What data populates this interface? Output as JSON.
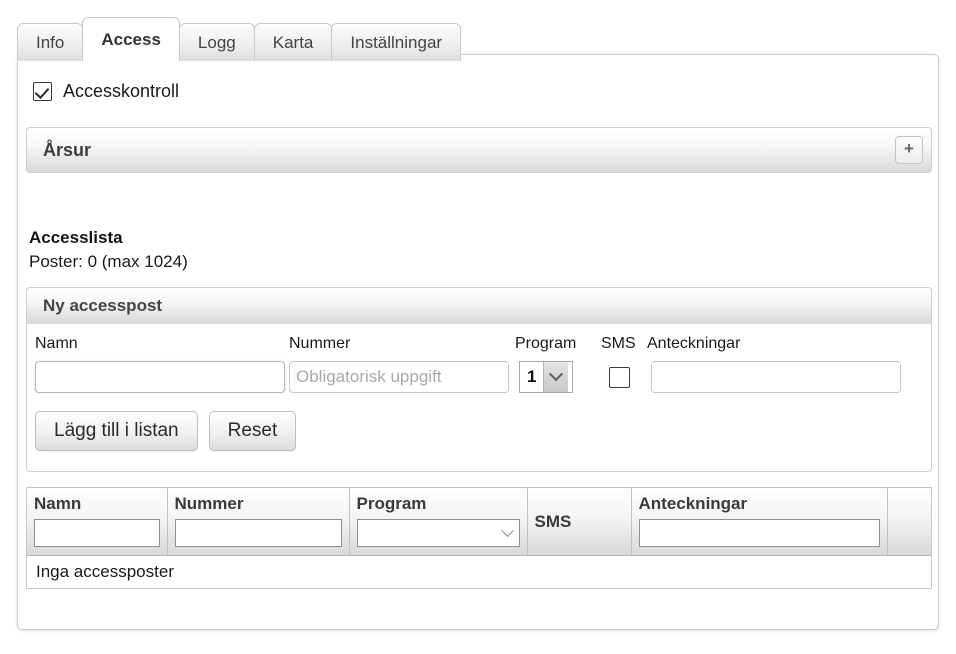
{
  "tabs": [
    {
      "label": "Info",
      "active": false
    },
    {
      "label": "Access",
      "active": true
    },
    {
      "label": "Logg",
      "active": false
    },
    {
      "label": "Karta",
      "active": false
    },
    {
      "label": "Inställningar",
      "active": false
    }
  ],
  "access_control": {
    "label": "Accesskontroll",
    "checked": true
  },
  "yearclock_panel": {
    "title": "Årsur",
    "add_button_label": "+",
    "add_button_icon": "plus-icon"
  },
  "access_list": {
    "title": "Accesslista",
    "count_text": "Poster: 0 (max 1024)"
  },
  "new_entry": {
    "header": "Ny accesspost",
    "labels": {
      "name": "Namn",
      "number": "Nummer",
      "program": "Program",
      "sms": "SMS",
      "notes": "Anteckningar"
    },
    "name_value": "",
    "name_placeholder": "",
    "number_value": "",
    "number_placeholder": "Obligatorisk uppgift",
    "program_value": "1",
    "program_options": [
      "1"
    ],
    "sms_checked": false,
    "notes_value": "",
    "notes_placeholder": "",
    "submit_label": "Lägg till i listan",
    "reset_label": "Reset"
  },
  "table": {
    "columns": [
      "Namn",
      "Nummer",
      "Program",
      "SMS",
      "Anteckningar",
      ""
    ],
    "filters": {
      "name": "",
      "number": "",
      "program": "",
      "notes": ""
    },
    "empty_message": "Inga accessposter",
    "rows": []
  },
  "colors": {
    "panel_border": "#cccccc",
    "header_gradient_end": "#d8d8d8",
    "text": "#222222",
    "placeholder": "#a9a9a9"
  }
}
